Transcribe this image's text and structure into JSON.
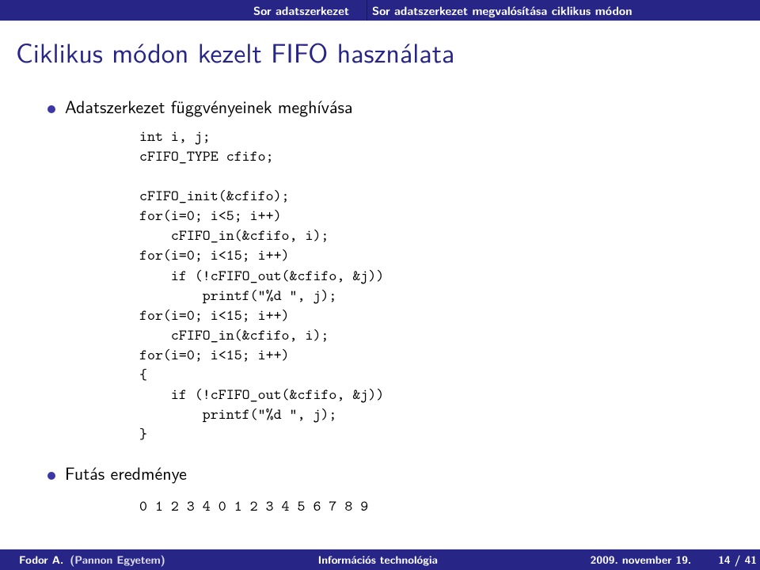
{
  "topbar": {
    "section": "Sor adatszerkezet",
    "subsection": "Sor adatszerkezet megvalósítása ciklikus módon"
  },
  "title": "Ciklikus módon kezelt FIFO használata",
  "bullets": {
    "b1": "Adatszerkezet függvényeinek meghívása",
    "b2": "Futás eredménye"
  },
  "code": "int i, j;\ncFIFO_TYPE cfifo;\n\ncFIFO_init(&cfifo);\nfor(i=0; i<5; i++)\n    cFIFO_in(&cfifo, i);\nfor(i=0; i<15; i++)\n    if (!cFIFO_out(&cfifo, &j))\n        printf(\"%d \", j);\nfor(i=0; i<15; i++)\n    cFIFO_in(&cfifo, i);\nfor(i=0; i<15; i++)\n{\n    if (!cFIFO_out(&cfifo, &j))\n        printf(\"%d \", j);\n}",
  "output": "0 1 2 3 4 0 1 2 3 4 5 6 7 8 9",
  "footer": {
    "author": "Fodor A.",
    "institution": "(Pannon Egyetem)",
    "short_title": "Információs technológia",
    "date": "2009. november 19.",
    "page": "14 / 41"
  }
}
